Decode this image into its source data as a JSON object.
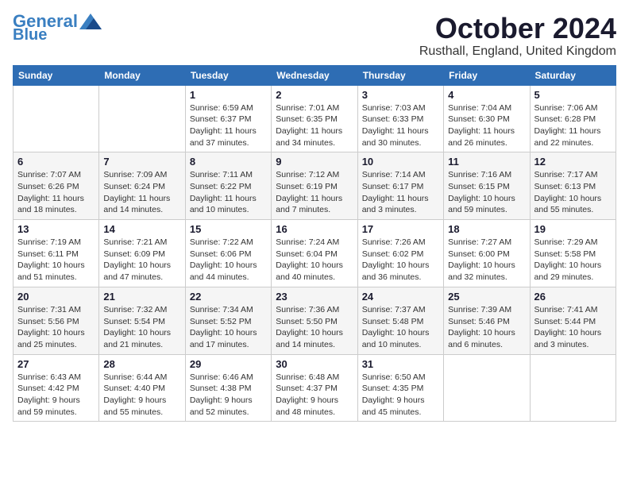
{
  "logo": {
    "line1": "General",
    "line2": "Blue"
  },
  "title": "October 2024",
  "location": "Rusthall, England, United Kingdom",
  "days_of_week": [
    "Sunday",
    "Monday",
    "Tuesday",
    "Wednesday",
    "Thursday",
    "Friday",
    "Saturday"
  ],
  "weeks": [
    [
      {
        "day": "",
        "info": ""
      },
      {
        "day": "",
        "info": ""
      },
      {
        "day": "1",
        "info": "Sunrise: 6:59 AM\nSunset: 6:37 PM\nDaylight: 11 hours and 37 minutes."
      },
      {
        "day": "2",
        "info": "Sunrise: 7:01 AM\nSunset: 6:35 PM\nDaylight: 11 hours and 34 minutes."
      },
      {
        "day": "3",
        "info": "Sunrise: 7:03 AM\nSunset: 6:33 PM\nDaylight: 11 hours and 30 minutes."
      },
      {
        "day": "4",
        "info": "Sunrise: 7:04 AM\nSunset: 6:30 PM\nDaylight: 11 hours and 26 minutes."
      },
      {
        "day": "5",
        "info": "Sunrise: 7:06 AM\nSunset: 6:28 PM\nDaylight: 11 hours and 22 minutes."
      }
    ],
    [
      {
        "day": "6",
        "info": "Sunrise: 7:07 AM\nSunset: 6:26 PM\nDaylight: 11 hours and 18 minutes."
      },
      {
        "day": "7",
        "info": "Sunrise: 7:09 AM\nSunset: 6:24 PM\nDaylight: 11 hours and 14 minutes."
      },
      {
        "day": "8",
        "info": "Sunrise: 7:11 AM\nSunset: 6:22 PM\nDaylight: 11 hours and 10 minutes."
      },
      {
        "day": "9",
        "info": "Sunrise: 7:12 AM\nSunset: 6:19 PM\nDaylight: 11 hours and 7 minutes."
      },
      {
        "day": "10",
        "info": "Sunrise: 7:14 AM\nSunset: 6:17 PM\nDaylight: 11 hours and 3 minutes."
      },
      {
        "day": "11",
        "info": "Sunrise: 7:16 AM\nSunset: 6:15 PM\nDaylight: 10 hours and 59 minutes."
      },
      {
        "day": "12",
        "info": "Sunrise: 7:17 AM\nSunset: 6:13 PM\nDaylight: 10 hours and 55 minutes."
      }
    ],
    [
      {
        "day": "13",
        "info": "Sunrise: 7:19 AM\nSunset: 6:11 PM\nDaylight: 10 hours and 51 minutes."
      },
      {
        "day": "14",
        "info": "Sunrise: 7:21 AM\nSunset: 6:09 PM\nDaylight: 10 hours and 47 minutes."
      },
      {
        "day": "15",
        "info": "Sunrise: 7:22 AM\nSunset: 6:06 PM\nDaylight: 10 hours and 44 minutes."
      },
      {
        "day": "16",
        "info": "Sunrise: 7:24 AM\nSunset: 6:04 PM\nDaylight: 10 hours and 40 minutes."
      },
      {
        "day": "17",
        "info": "Sunrise: 7:26 AM\nSunset: 6:02 PM\nDaylight: 10 hours and 36 minutes."
      },
      {
        "day": "18",
        "info": "Sunrise: 7:27 AM\nSunset: 6:00 PM\nDaylight: 10 hours and 32 minutes."
      },
      {
        "day": "19",
        "info": "Sunrise: 7:29 AM\nSunset: 5:58 PM\nDaylight: 10 hours and 29 minutes."
      }
    ],
    [
      {
        "day": "20",
        "info": "Sunrise: 7:31 AM\nSunset: 5:56 PM\nDaylight: 10 hours and 25 minutes."
      },
      {
        "day": "21",
        "info": "Sunrise: 7:32 AM\nSunset: 5:54 PM\nDaylight: 10 hours and 21 minutes."
      },
      {
        "day": "22",
        "info": "Sunrise: 7:34 AM\nSunset: 5:52 PM\nDaylight: 10 hours and 17 minutes."
      },
      {
        "day": "23",
        "info": "Sunrise: 7:36 AM\nSunset: 5:50 PM\nDaylight: 10 hours and 14 minutes."
      },
      {
        "day": "24",
        "info": "Sunrise: 7:37 AM\nSunset: 5:48 PM\nDaylight: 10 hours and 10 minutes."
      },
      {
        "day": "25",
        "info": "Sunrise: 7:39 AM\nSunset: 5:46 PM\nDaylight: 10 hours and 6 minutes."
      },
      {
        "day": "26",
        "info": "Sunrise: 7:41 AM\nSunset: 5:44 PM\nDaylight: 10 hours and 3 minutes."
      }
    ],
    [
      {
        "day": "27",
        "info": "Sunrise: 6:43 AM\nSunset: 4:42 PM\nDaylight: 9 hours and 59 minutes."
      },
      {
        "day": "28",
        "info": "Sunrise: 6:44 AM\nSunset: 4:40 PM\nDaylight: 9 hours and 55 minutes."
      },
      {
        "day": "29",
        "info": "Sunrise: 6:46 AM\nSunset: 4:38 PM\nDaylight: 9 hours and 52 minutes."
      },
      {
        "day": "30",
        "info": "Sunrise: 6:48 AM\nSunset: 4:37 PM\nDaylight: 9 hours and 48 minutes."
      },
      {
        "day": "31",
        "info": "Sunrise: 6:50 AM\nSunset: 4:35 PM\nDaylight: 9 hours and 45 minutes."
      },
      {
        "day": "",
        "info": ""
      },
      {
        "day": "",
        "info": ""
      }
    ]
  ]
}
